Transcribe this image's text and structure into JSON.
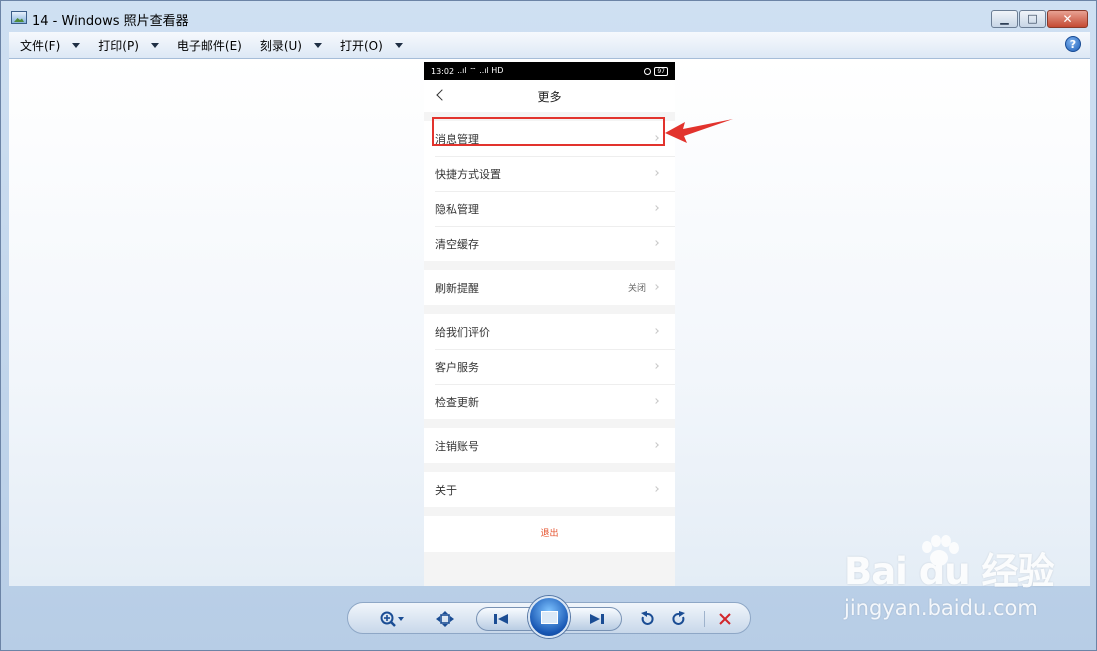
{
  "window": {
    "title": "14 - Windows 照片查看器",
    "buttons": {
      "minimize": "▁",
      "maximize": "□",
      "close": "✕"
    }
  },
  "menubar": {
    "items": [
      {
        "label": "文件(F)"
      },
      {
        "label": "打印(P)"
      },
      {
        "label": "电子邮件(E)"
      },
      {
        "label": "刻录(U)"
      },
      {
        "label": "打开(O)"
      }
    ],
    "help": "?"
  },
  "phone": {
    "status": {
      "time": "13:02",
      "signal": "..ıl ⌔ ..ıl HD",
      "battery": "97"
    },
    "nav": {
      "title": "更多"
    },
    "groups": [
      {
        "rows": [
          {
            "label": "消息管理"
          },
          {
            "label": "快捷方式设置"
          },
          {
            "label": "隐私管理"
          },
          {
            "label": "清空缓存"
          }
        ]
      },
      {
        "rows": [
          {
            "label": "刷新提醒",
            "value": "关闭"
          }
        ]
      },
      {
        "rows": [
          {
            "label": "给我们评价"
          },
          {
            "label": "客户服务"
          },
          {
            "label": "检查更新"
          }
        ]
      },
      {
        "rows": [
          {
            "label": "注销账号"
          }
        ]
      },
      {
        "rows": [
          {
            "label": "关于"
          }
        ]
      }
    ],
    "logout": "退出"
  },
  "annotation": {
    "color": "#e2332d"
  },
  "watermark": {
    "logo": "Bai  du 经验",
    "url": "jingyan.baidu.com"
  },
  "colors": {
    "accent": "#1b4d94",
    "delete": "#d2262b",
    "logout": "#e5532e"
  }
}
